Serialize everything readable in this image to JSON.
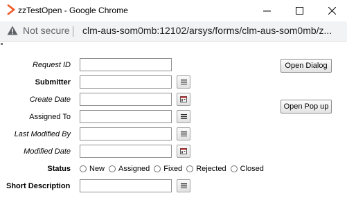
{
  "window": {
    "title": "zzTestOpen - Google Chrome"
  },
  "address_bar": {
    "security_label": "Not secure",
    "url": "clm-aus-som0mb:12102/arsys/forms/clm-aus-som0mb/z..."
  },
  "form": {
    "fields": [
      {
        "label": "Request ID",
        "value": "",
        "side_button_icon": null
      },
      {
        "label": "Submitter",
        "value": "",
        "side_button_icon": "menu-icon"
      },
      {
        "label": "Create Date",
        "value": "",
        "side_button_icon": "calendar-icon"
      },
      {
        "label": "Assigned To",
        "value": "",
        "side_button_icon": "menu-icon"
      },
      {
        "label": "Last Modified By",
        "value": "",
        "side_button_icon": "menu-icon"
      },
      {
        "label": "Modified Date",
        "value": "",
        "side_button_icon": "calendar-icon"
      }
    ],
    "status": {
      "label": "Status",
      "options": [
        "New",
        "Assigned",
        "Fixed",
        "Rejected",
        "Closed"
      ],
      "selected": null
    },
    "short_description": {
      "label": "Short Description",
      "value": "",
      "side_button_icon": "menu-icon"
    },
    "buttons": {
      "open_dialog": "Open Dialog",
      "open_popup": "Open Pop up"
    }
  }
}
